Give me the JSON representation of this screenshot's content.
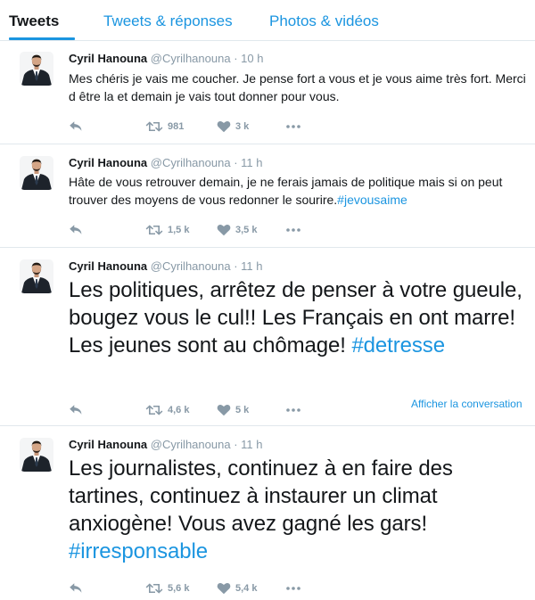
{
  "tabs": [
    {
      "label": "Tweets",
      "active": true
    },
    {
      "label": "Tweets & réponses",
      "active": false
    },
    {
      "label": "Photos & vidéos",
      "active": false
    }
  ],
  "colors": {
    "accent": "#1b95e0",
    "muted": "#8899a6",
    "divider": "#e1e8ed",
    "text": "#14171a"
  },
  "tweets": [
    {
      "name": "Cyril Hanouna",
      "handle": "@Cyrilhanouna",
      "sep": "·",
      "time": "10 h",
      "text": "Mes chéris je vais me coucher. Je pense fort a vous et je vous aime très fort. Merci d être la et demain je vais tout donner pour vous.",
      "hashtag": "",
      "retweets": "981",
      "likes": "3 k"
    },
    {
      "name": "Cyril Hanouna",
      "handle": "@Cyrilhanouna",
      "sep": "·",
      "time": "11 h",
      "text": "Hâte de vous retrouver demain, je ne ferais jamais de politique mais si on peut trouver des moyens de vous redonner le sourire.",
      "hashtag": "#jevousaime",
      "retweets": "1,5 k",
      "likes": "3,5 k"
    },
    {
      "name": "Cyril Hanouna",
      "handle": "@Cyrilhanouna",
      "sep": "·",
      "time": "11 h",
      "text": "Les politiques, arrêtez de penser à votre gueule, bougez vous le cul!! Les Français en ont marre! Les jeunes sont au chômage!",
      "hashtag": "#detresse",
      "retweets": "4,6 k",
      "likes": "5 k",
      "conversation_link": "Afficher la conversation"
    },
    {
      "name": "Cyril Hanouna",
      "handle": "@Cyrilhanouna",
      "sep": "·",
      "time": "11 h",
      "text": "Les journalistes, continuez à en faire des tartines, continuez à instaurer un climat anxiogène! Vous avez gagné les gars!",
      "hashtag": "#irresponsable",
      "retweets": "5,6 k",
      "likes": "5,4 k"
    }
  ],
  "icons": {
    "reply": "reply-icon",
    "retweet": "retweet-icon",
    "like": "heart-icon",
    "more": "more-dots-icon",
    "avatar": "avatar"
  }
}
